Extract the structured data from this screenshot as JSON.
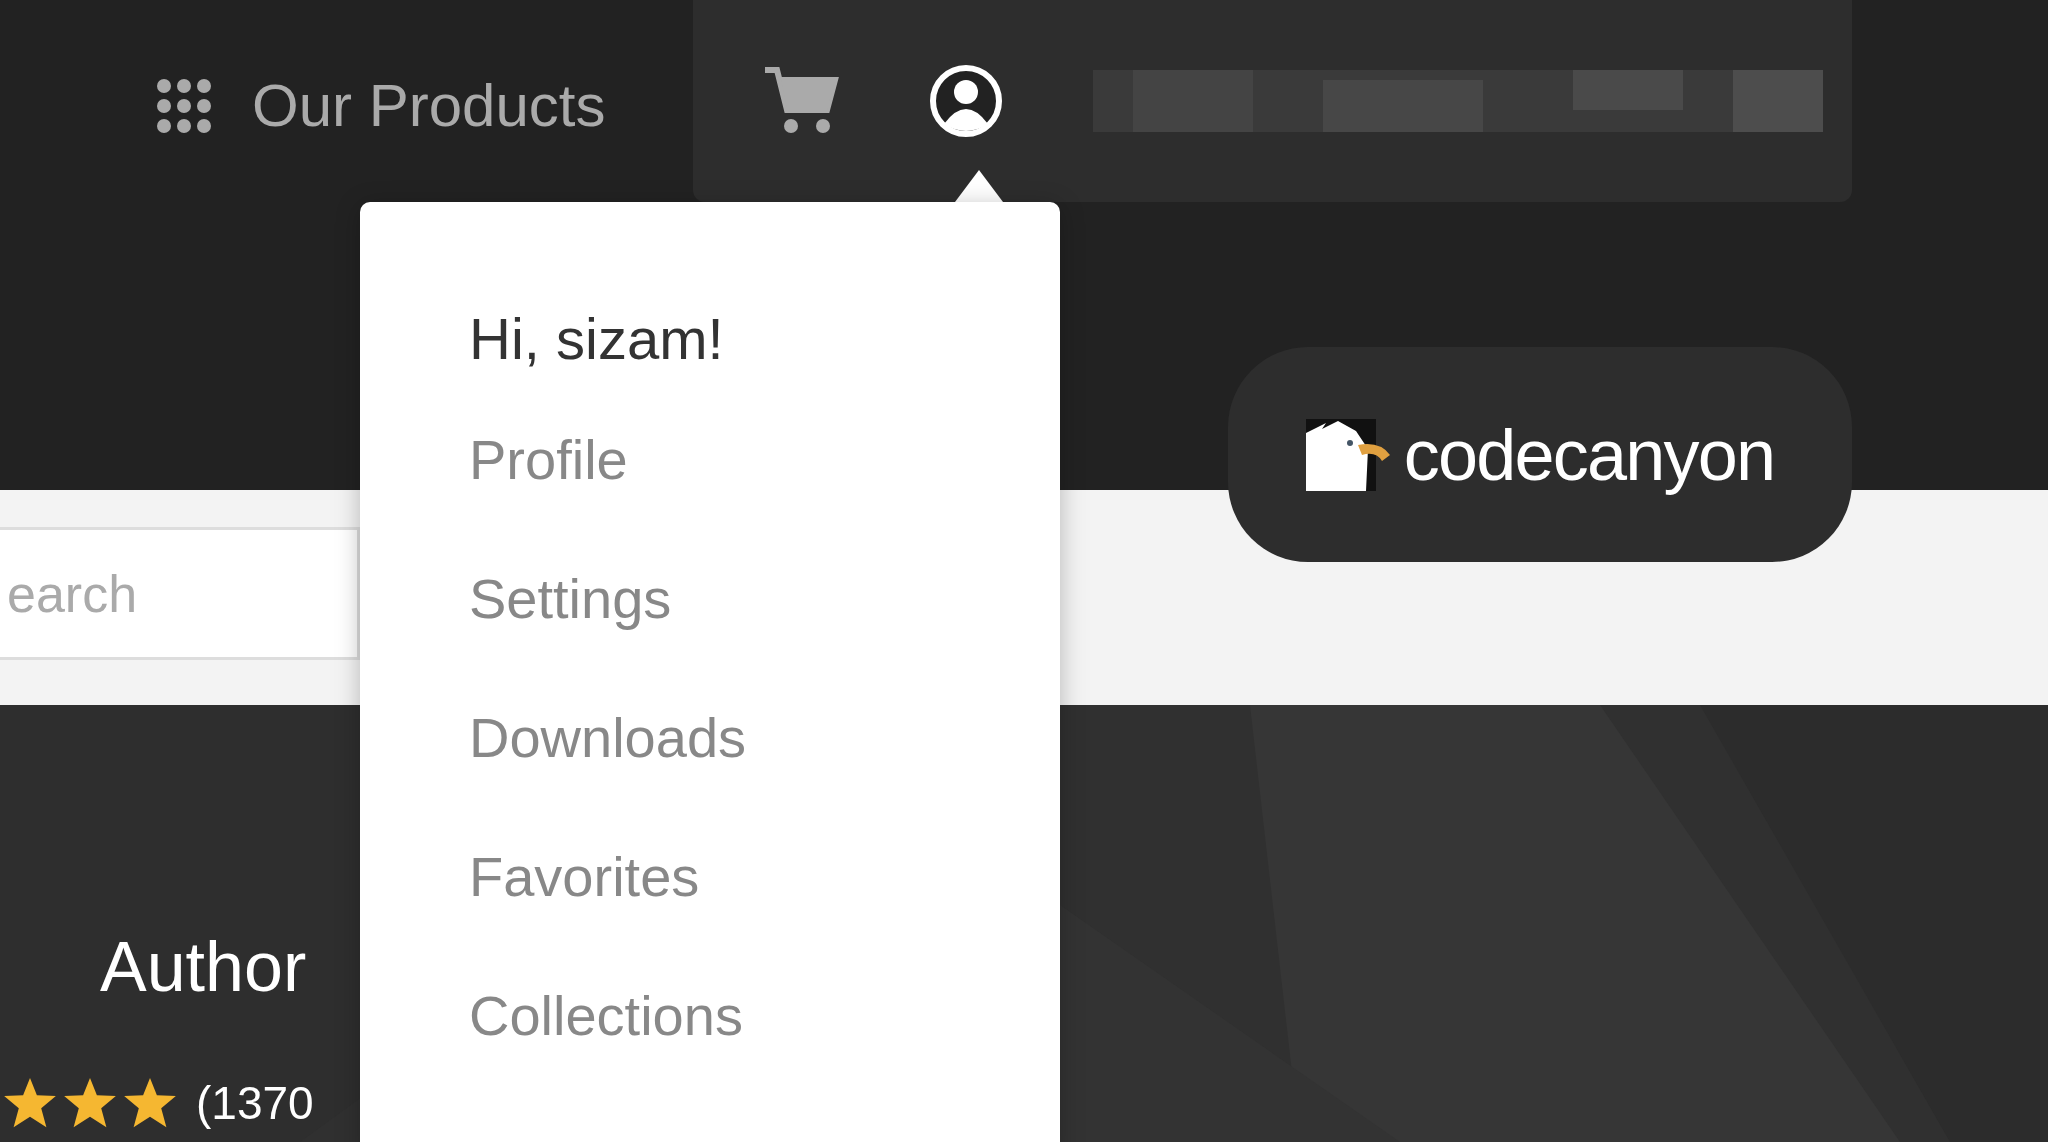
{
  "header": {
    "products_label": "Our Products"
  },
  "account_menu": {
    "greeting": "Hi, sizam!",
    "items": [
      {
        "label": "Profile"
      },
      {
        "label": "Settings"
      },
      {
        "label": "Downloads"
      },
      {
        "label": "Favorites"
      },
      {
        "label": "Collections"
      }
    ]
  },
  "logo": {
    "text": "codecanyon"
  },
  "search": {
    "placeholder": "earch"
  },
  "author": {
    "heading": "Author",
    "stars": 3,
    "reviews": "(1370"
  }
}
